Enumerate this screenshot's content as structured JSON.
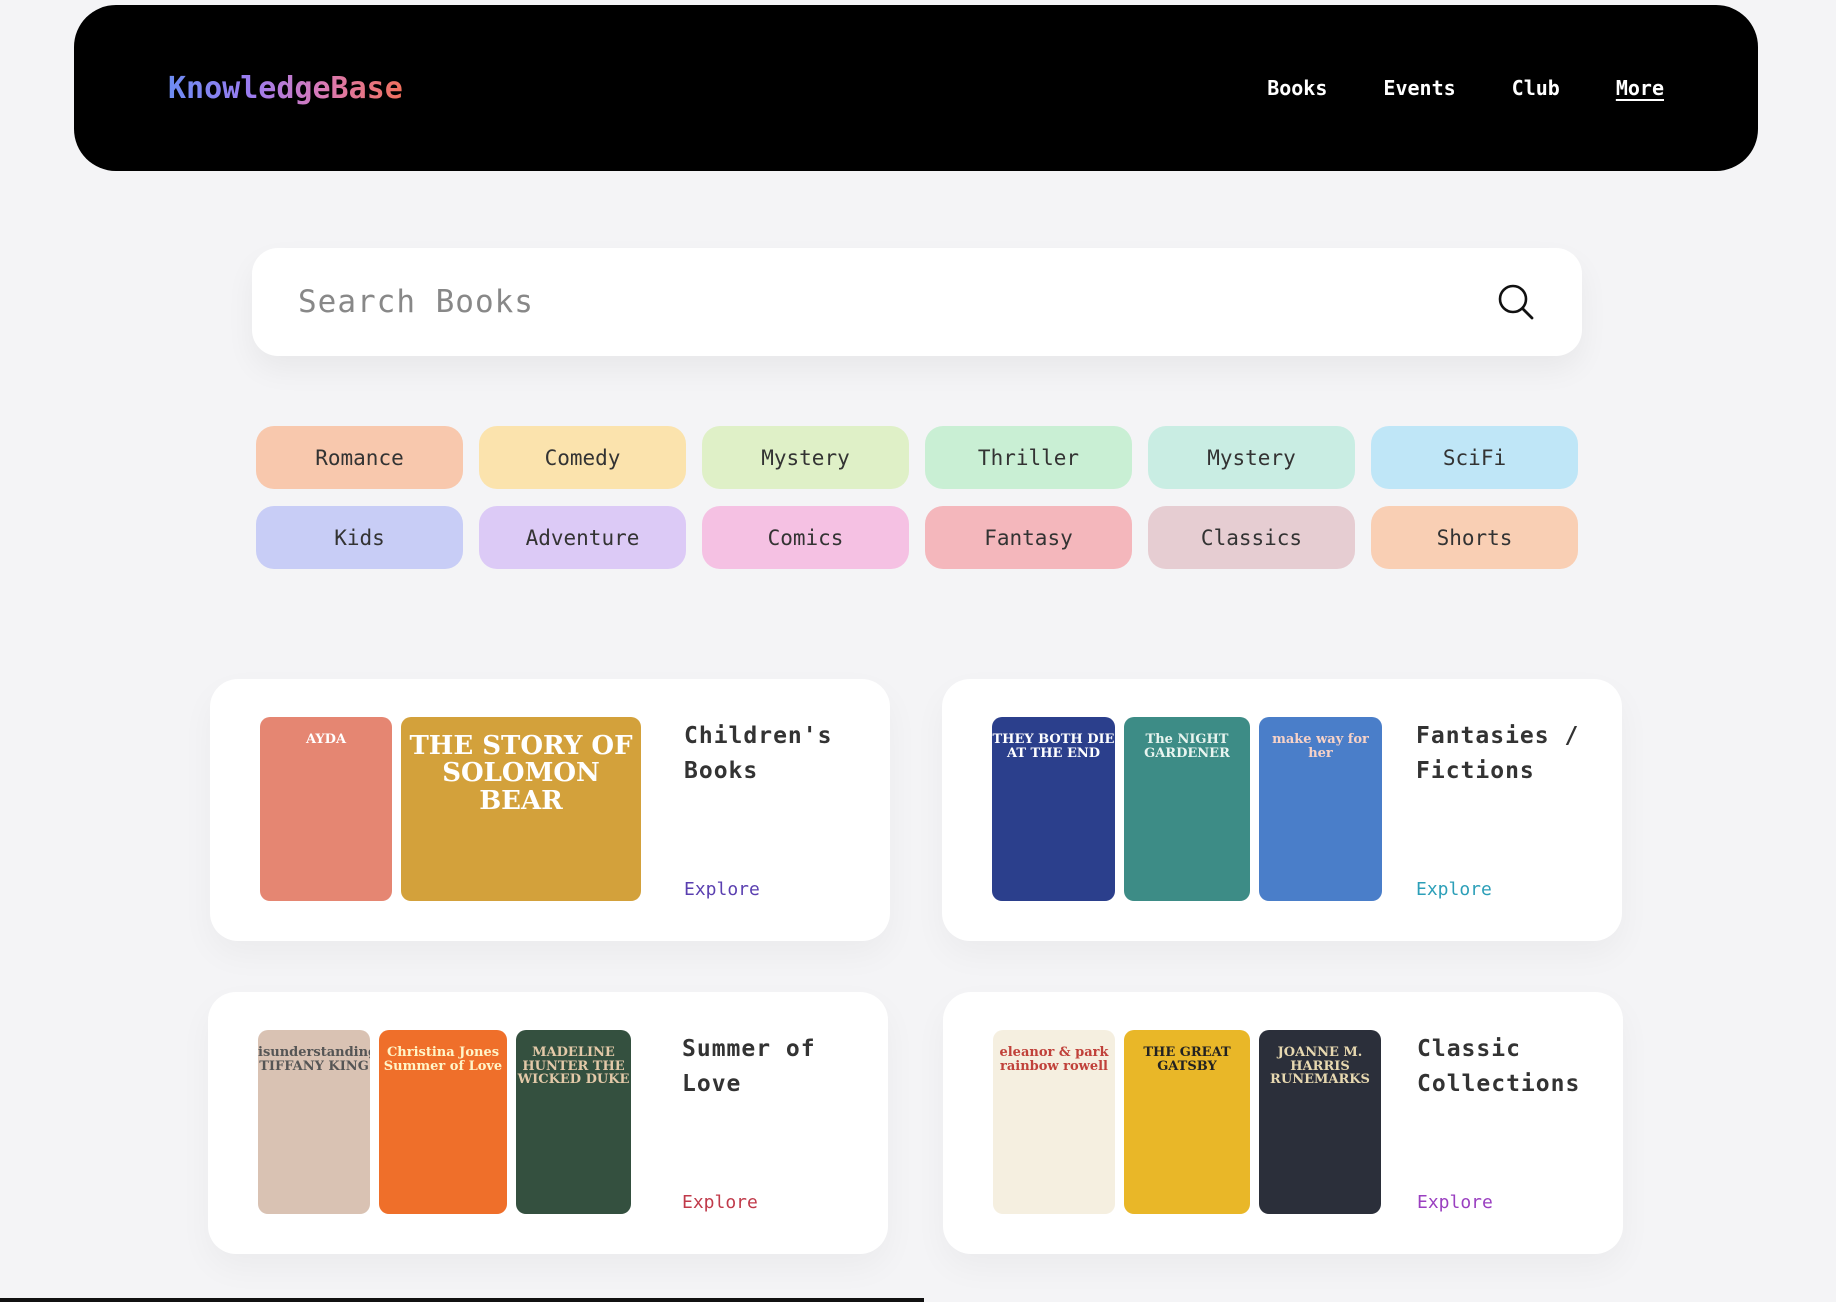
{
  "header": {
    "logo": "KnowledgeBase",
    "nav": [
      "Books",
      "Events",
      "Club",
      "More"
    ]
  },
  "search": {
    "placeholder": "Search Books"
  },
  "genres": [
    {
      "label": "Romance",
      "color": "#f8c8ad"
    },
    {
      "label": "Comedy",
      "color": "#fbe3ad"
    },
    {
      "label": "Mystery",
      "color": "#dff0c7"
    },
    {
      "label": "Thriller",
      "color": "#c9efd4"
    },
    {
      "label": "Mystery",
      "color": "#c9ede3"
    },
    {
      "label": "SciFi",
      "color": "#bfe6f7"
    },
    {
      "label": "Kids",
      "color": "#c8cdf6"
    },
    {
      "label": "Adventure",
      "color": "#dccaf6"
    },
    {
      "label": "Comics",
      "color": "#f5c1e3"
    },
    {
      "label": "Fantasy",
      "color": "#f4b7bc"
    },
    {
      "label": "Classics",
      "color": "#e6cdd2"
    },
    {
      "label": "Shorts",
      "color": "#f9cfb4"
    }
  ],
  "collections": [
    {
      "title": "Children's Books",
      "explore": "Explore",
      "explore_color": "#5a3fb0",
      "covers": [
        {
          "title": "AYDA",
          "bg": "#e58672",
          "fg": "#fff"
        },
        {
          "title": "THE STORY OF SOLOMON BEAR",
          "bg": "#d3a13b",
          "fg": "#fff"
        }
      ]
    },
    {
      "title": "Fantasies / Fictions",
      "explore": "Explore",
      "explore_color": "#2c9fb8",
      "covers": [
        {
          "title": "THEY BOTH DIE AT THE END",
          "bg": "#2b3f8c",
          "fg": "#fff"
        },
        {
          "title": "The NIGHT GARDENER",
          "bg": "#3d8c86",
          "fg": "#e8f4ef"
        },
        {
          "title": "make way for her",
          "bg": "#4a7ec9",
          "fg": "#f7d2c7"
        }
      ]
    },
    {
      "title": "Summer of Love",
      "explore": "Explore",
      "explore_color": "#c03a4a",
      "covers": [
        {
          "title": "isunderstandings TIFFANY KING",
          "bg": "#d9c2b3",
          "fg": "#555"
        },
        {
          "title": "Christina Jones Summer of Love",
          "bg": "#ef6f2a",
          "fg": "#fff5c8"
        },
        {
          "title": "MADELINE HUNTER THE WICKED DUKE",
          "bg": "#34503f",
          "fg": "#e3c9a8"
        }
      ]
    },
    {
      "title": "Classic Collections",
      "explore": "Explore",
      "explore_color": "#9a3fc0",
      "covers": [
        {
          "title": "eleanor & park rainbow rowell",
          "bg": "#f5efe0",
          "fg": "#c0413a"
        },
        {
          "title": "THE GREAT GATSBY",
          "bg": "#e9b728",
          "fg": "#222"
        },
        {
          "title": "JOANNE M. HARRIS RUNEMARKS",
          "bg": "#2b2f3a",
          "fg": "#e7d8b0"
        }
      ]
    }
  ]
}
